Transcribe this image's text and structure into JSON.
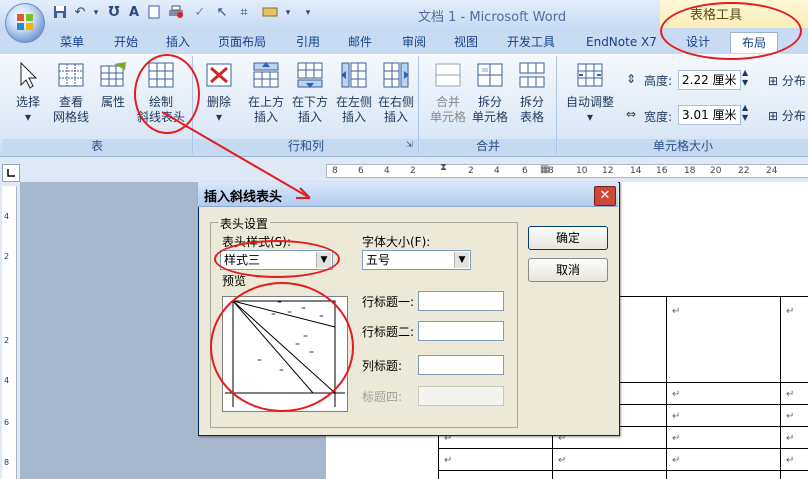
{
  "window": {
    "title": "文档 1 - Microsoft Word",
    "context_tool": "表格工具"
  },
  "tabs": [
    {
      "label": "菜单",
      "active": false
    },
    {
      "label": "开始",
      "active": false
    },
    {
      "label": "插入",
      "active": false
    },
    {
      "label": "页面布局",
      "active": false
    },
    {
      "label": "引用",
      "active": false
    },
    {
      "label": "邮件",
      "active": false
    },
    {
      "label": "审阅",
      "active": false
    },
    {
      "label": "视图",
      "active": false
    },
    {
      "label": "开发工具",
      "active": false
    },
    {
      "label": "EndNote X7",
      "active": false
    },
    {
      "label": "设计",
      "active": false
    },
    {
      "label": "布局",
      "active": true
    }
  ],
  "ribbon": {
    "group_table": {
      "label": "表",
      "buttons": [
        {
          "l1": "选择",
          "l2": "▾"
        },
        {
          "l1": "查看",
          "l2": "网格线"
        },
        {
          "l1": "属性",
          "l2": ""
        },
        {
          "l1": "绘制",
          "l2": "斜线表头"
        }
      ]
    },
    "group_rowcol": {
      "label": "行和列",
      "buttons": [
        {
          "l1": "删除",
          "l2": "▾"
        },
        {
          "l1": "在上方",
          "l2": "插入"
        },
        {
          "l1": "在下方",
          "l2": "插入"
        },
        {
          "l1": "在左侧",
          "l2": "插入"
        },
        {
          "l1": "在右侧",
          "l2": "插入"
        }
      ]
    },
    "group_merge": {
      "label": "合并",
      "buttons": [
        {
          "l1": "合并",
          "l2": "单元格"
        },
        {
          "l1": "拆分",
          "l2": "单元格"
        },
        {
          "l1": "拆分",
          "l2": "表格"
        }
      ]
    },
    "group_cellsize": {
      "label": "单元格大小",
      "autofit_l1": "自动调整",
      "autofit_l2": "▾",
      "height_label": "高度:",
      "height_value": "2.22 厘米",
      "width_label": "宽度:",
      "width_value": "3.01 厘米",
      "distribute_rows": "分布",
      "distribute_cols": "分布"
    }
  },
  "ruler": {
    "ticks": [
      "8",
      "6",
      "4",
      "2",
      "2",
      "4",
      "6",
      "8",
      "10",
      "12",
      "14",
      "16",
      "18",
      "20",
      "22",
      "24"
    ],
    "vticks": [
      "4",
      "2",
      "2",
      "4",
      "6",
      "8"
    ]
  },
  "dialog": {
    "title": "插入斜线表头",
    "section": "表头设置",
    "style_label": "表头样式(S):",
    "style_value": "样式三",
    "fontsize_label": "字体大小(F):",
    "fontsize_value": "五号",
    "preview_label": "预览",
    "row_title1": "行标题一:",
    "row_title2": "行标题二:",
    "col_title": "列标题:",
    "title4": "标题四:",
    "ok": "确定",
    "cancel": "取消",
    "preview_marks": [
      "=",
      "=",
      "=",
      "=",
      "=",
      "=",
      "=",
      "=",
      "=",
      "="
    ]
  },
  "table": {
    "cell_mark": "↵"
  }
}
